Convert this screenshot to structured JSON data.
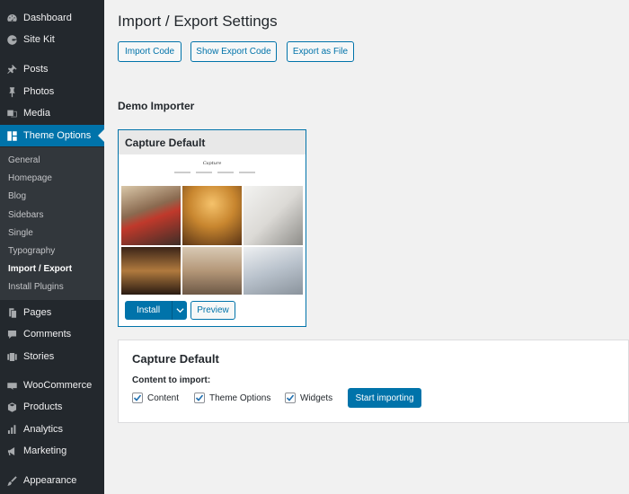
{
  "sidebar": {
    "menu": [
      {
        "label": "Dashboard",
        "icon": "dashboard-icon"
      },
      {
        "label": "Site Kit",
        "icon": "google-g-icon"
      },
      {
        "label": "Posts",
        "icon": "pushpin-icon"
      },
      {
        "label": "Photos",
        "icon": "pin-icon"
      },
      {
        "label": "Media",
        "icon": "media-icon"
      },
      {
        "label": "Theme Options",
        "icon": "theme-options-icon"
      },
      {
        "label": "Pages",
        "icon": "pages-icon"
      },
      {
        "label": "Comments",
        "icon": "comment-icon"
      },
      {
        "label": "Stories",
        "icon": "stories-icon"
      },
      {
        "label": "WooCommerce",
        "icon": "woocommerce-icon"
      },
      {
        "label": "Products",
        "icon": "box-icon"
      },
      {
        "label": "Analytics",
        "icon": "bar-chart-icon"
      },
      {
        "label": "Marketing",
        "icon": "megaphone-icon"
      },
      {
        "label": "Appearance",
        "icon": "paintbrush-icon"
      }
    ],
    "submenu": [
      "General",
      "Homepage",
      "Blog",
      "Sidebars",
      "Single",
      "Typography",
      "Import / Export",
      "Install Plugins"
    ],
    "active_color": "#0073aa"
  },
  "page": {
    "title": "Import / Export Settings",
    "buttons": {
      "import_code": "Import Code",
      "show_export_code": "Show Export Code",
      "export_as_file": "Export as File"
    },
    "demo_section_title": "Demo Importer"
  },
  "demo_card": {
    "title": "Capture Default",
    "preview_logo": "Capture",
    "install_label": "Install",
    "preview_label": "Preview"
  },
  "import_panel": {
    "title": "Capture Default",
    "content_label": "Content to import:",
    "options": [
      {
        "label": "Content",
        "checked": true
      },
      {
        "label": "Theme Options",
        "checked": true
      },
      {
        "label": "Widgets",
        "checked": true
      }
    ],
    "start_label": "Start importing"
  }
}
